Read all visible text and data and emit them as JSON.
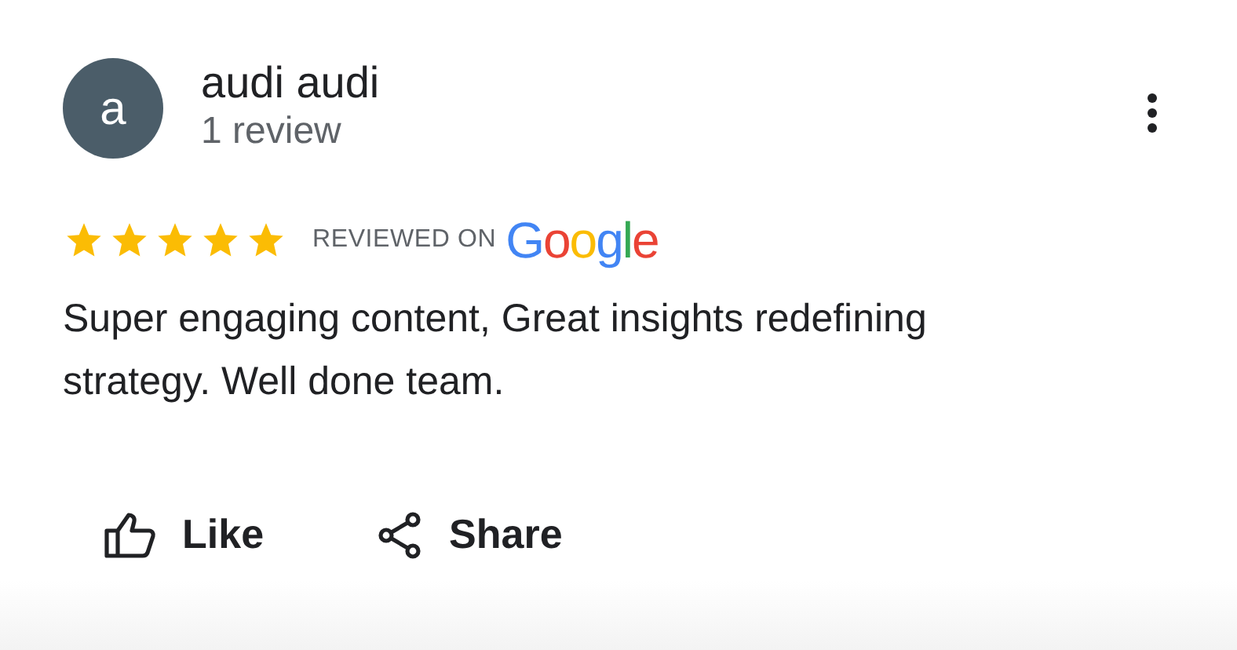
{
  "reviewer": {
    "initial": "a",
    "name": "audi audi",
    "review_count": "1 review"
  },
  "rating": {
    "stars": 5,
    "source_label": "REVIEWED ON",
    "source_logo": "Google"
  },
  "review_text": "Super engaging content, Great insights redefining strategy. Well done team.",
  "actions": [
    {
      "kind": "like",
      "label": "Like"
    },
    {
      "kind": "share",
      "label": "Share"
    }
  ]
}
